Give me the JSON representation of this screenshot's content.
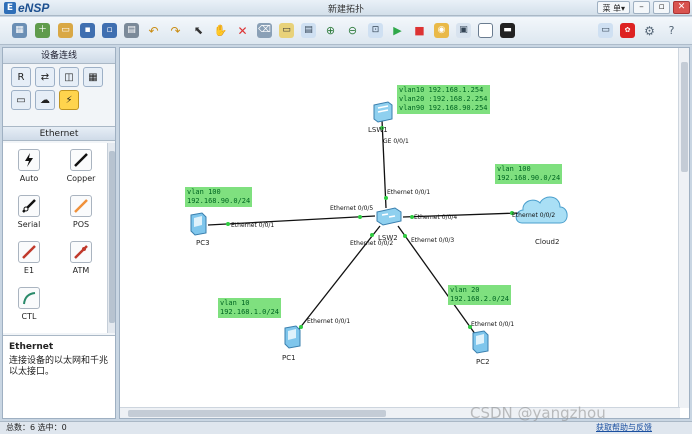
{
  "app": {
    "name": "eNSP",
    "window_title": "新建拓扑"
  },
  "menu_label": "菜 单▾",
  "panel": {
    "title": "设备连线",
    "section": "Ethernet",
    "cables": [
      "Auto",
      "Copper",
      "Serial",
      "POS",
      "E1",
      "ATM",
      "CTL"
    ],
    "desc_title": "Ethernet",
    "desc_text": "连接设备的以太网和千兆以太接口。"
  },
  "devices": {
    "lsw1": "LSW1",
    "lsw2": "LSW2",
    "pc1": "PC1",
    "pc2": "PC2",
    "pc3": "PC3",
    "cloud2": "Cloud2"
  },
  "notes": {
    "lsw1": [
      "vlan10 192.168.1.254",
      "vlan20 :192.168.2.254",
      "vlan90 192.168.90.254"
    ],
    "cloud": [
      "vlan 100",
      "192.168.90.0/24"
    ],
    "pc3": [
      "vlan 100",
      "192.168.90.0/24"
    ],
    "pc1": [
      "vlan 10",
      "192.168.1.0/24"
    ],
    "pc2": [
      "vlan 20",
      "192.168.2.0/24"
    ]
  },
  "ports": {
    "lsw1_down": "GE 0/0/1",
    "lsw2_up": "Ethernet 0/0/1",
    "lsw2_left": "Ethernet 0/0/5",
    "pc3_port": "Ethernet 0/0/1",
    "lsw2_right": "Ethernet 0/0/4",
    "cloud_port": "Ethernet 0/0/2",
    "lsw2_pc1": "Ethernet 0/0/2",
    "lsw2_pc2": "Ethernet 0/0/3",
    "pc1_port": "Ethernet 0/0/1",
    "pc2_port": "Ethernet 0/0/1"
  },
  "status": {
    "summary": "总数：6  选中：0",
    "help": "获取帮助与反馈"
  },
  "watermark": "CSDN @yangzhou",
  "colors": {
    "note_bg": "#7fe07f",
    "link_line": "#111111",
    "port_dot": "#2ecc40"
  }
}
